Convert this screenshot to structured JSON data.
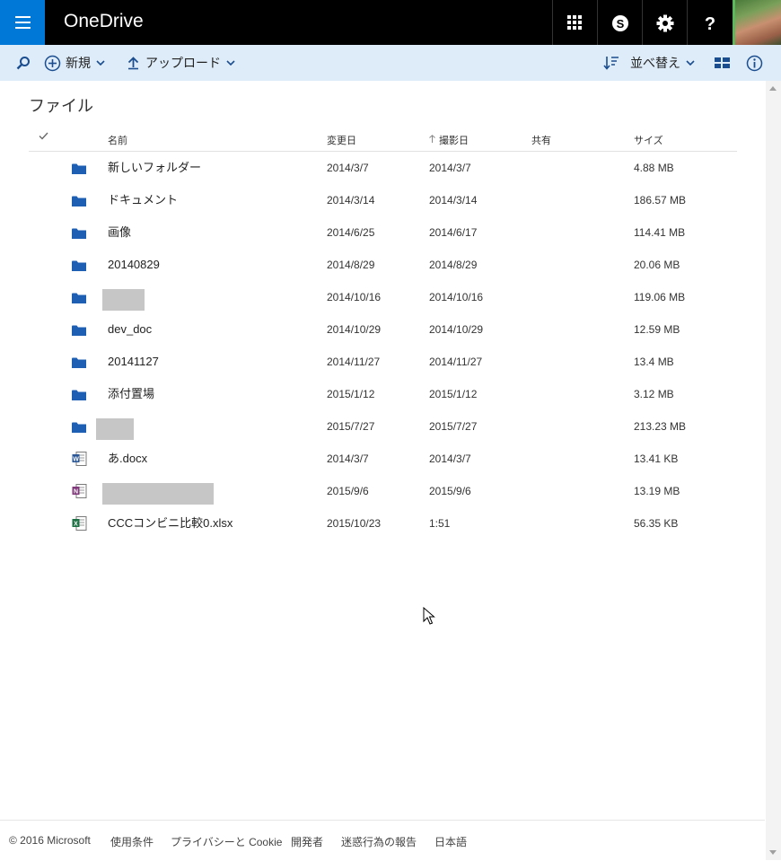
{
  "header": {
    "app_name": "OneDrive",
    "icons": [
      "menu-icon",
      "app-launcher-icon",
      "skype-icon",
      "settings-gear-icon",
      "help-icon"
    ],
    "accent_color": "#0078d7"
  },
  "commandbar": {
    "new_label": "新規",
    "upload_label": "アップロード",
    "sort_label": "並べ替え"
  },
  "page": {
    "title": "ファイル"
  },
  "columns": {
    "name": "名前",
    "modified": "変更日",
    "taken": "撮影日",
    "shared": "共有",
    "size": "サイズ"
  },
  "files": [
    {
      "name": "新しいフォルダー",
      "type": "folder",
      "modified": "2014/3/7",
      "taken": "2014/3/7",
      "size": "4.88 MB"
    },
    {
      "name": "ドキュメント",
      "type": "folder",
      "modified": "2014/3/14",
      "taken": "2014/3/14",
      "size": "186.57 MB"
    },
    {
      "name": "画像",
      "type": "folder",
      "modified": "2014/6/25",
      "taken": "2014/6/17",
      "size": "114.41 MB"
    },
    {
      "name": "20140829",
      "type": "folder",
      "modified": "2014/8/29",
      "taken": "2014/8/29",
      "size": "20.06 MB"
    },
    {
      "name": "",
      "type": "folder",
      "redacted": true,
      "modified": "2014/10/16",
      "taken": "2014/10/16",
      "size": "119.06 MB"
    },
    {
      "name": "dev_doc",
      "type": "folder",
      "modified": "2014/10/29",
      "taken": "2014/10/29",
      "size": "12.59 MB"
    },
    {
      "name": "20141127",
      "type": "folder",
      "modified": "2014/11/27",
      "taken": "2014/11/27",
      "size": "13.4 MB"
    },
    {
      "name": "添付置場",
      "type": "folder",
      "modified": "2015/1/12",
      "taken": "2015/1/12",
      "size": "3.12 MB"
    },
    {
      "name": "",
      "type": "folder",
      "redacted": true,
      "modified": "2015/7/27",
      "taken": "2015/7/27",
      "size": "213.23 MB"
    },
    {
      "name": "あ.docx",
      "type": "word",
      "modified": "2014/3/7",
      "taken": "2014/3/7",
      "size": "13.41 KB"
    },
    {
      "name": "",
      "type": "onenote",
      "redacted": true,
      "modified": "2015/9/6",
      "taken": "2015/9/6",
      "size": "13.19 MB"
    },
    {
      "name": "CCCコンビニ比較0.xlsx",
      "type": "excel",
      "modified": "2015/10/23",
      "taken": "1:51",
      "size": "56.35 KB"
    }
  ],
  "footer": {
    "copyright": "© 2016 Microsoft",
    "terms": "使用条件",
    "privacy": "プライバシーと Cookie",
    "developers": "開発者",
    "report_abuse": "迷惑行為の報告",
    "language": "日本語"
  }
}
